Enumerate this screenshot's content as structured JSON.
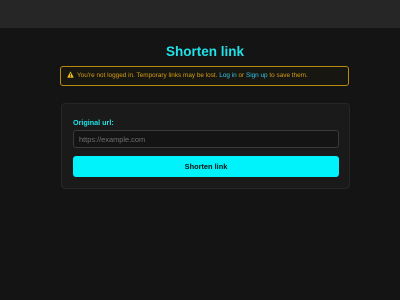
{
  "page": {
    "title": "Shorten link"
  },
  "warning": {
    "icon": "warning-triangle-icon",
    "text_before": "You're not logged in. Temporary links may be lost.",
    "login_label": "Log in",
    "or_text": "or",
    "signup_label": "Sign up",
    "text_after": "to save them."
  },
  "form": {
    "url_label": "Original url:",
    "url_value": "",
    "url_placeholder": "https://example.com",
    "submit_label": "Shorten link"
  },
  "colors": {
    "background": "#141414",
    "topbar": "#262626",
    "accent": "#1fe3e8",
    "button": "#00f3fb",
    "warning": "#d39e14",
    "link": "#34c4ea"
  }
}
